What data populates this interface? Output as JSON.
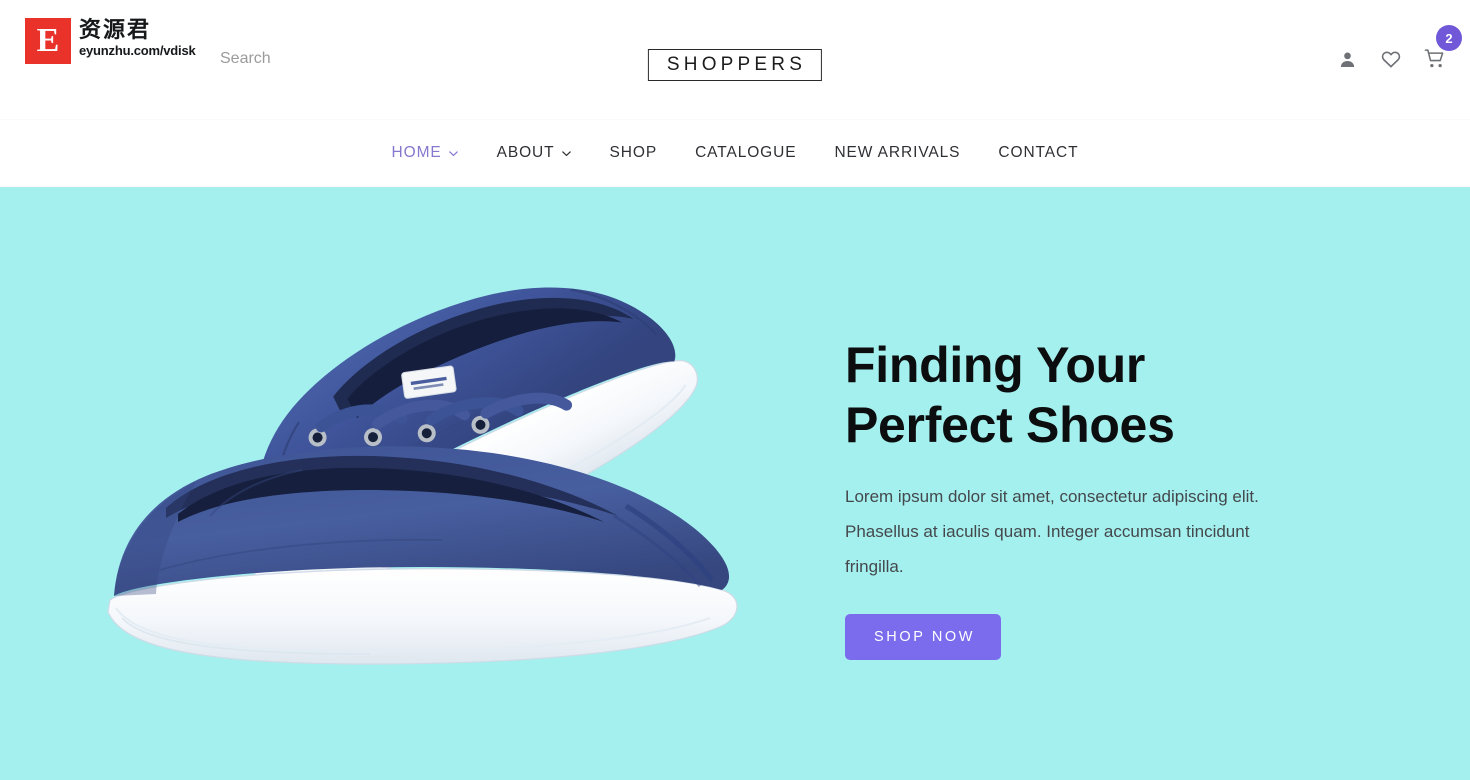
{
  "header": {
    "brand": {
      "mark_letter": "E",
      "mark_color": "#e8322a",
      "chinese_name": "资源君",
      "url": "eyunzhu.com/vdisk"
    },
    "search": {
      "placeholder": "Search",
      "value": ""
    },
    "site_logo": "SHOPPERS",
    "actions": [
      {
        "name": "account-icon",
        "label": "Account"
      },
      {
        "name": "heart-icon",
        "label": "Wishlist"
      },
      {
        "name": "cart-icon",
        "label": "Cart"
      }
    ],
    "cart_count": "2",
    "cart_badge_color": "#7158d8"
  },
  "nav": {
    "items": [
      {
        "label": "HOME",
        "active": true,
        "has_dropdown": true
      },
      {
        "label": "ABOUT",
        "active": false,
        "has_dropdown": true
      },
      {
        "label": "SHOP",
        "active": false,
        "has_dropdown": false
      },
      {
        "label": "CATALOGUE",
        "active": false,
        "has_dropdown": false
      },
      {
        "label": "NEW ARRIVALS",
        "active": false,
        "has_dropdown": false
      },
      {
        "label": "CONTACT",
        "active": false,
        "has_dropdown": false
      }
    ],
    "active_color": "#8777cf"
  },
  "hero": {
    "background_color": "#a4f0ee",
    "title_line1": "Finding Your",
    "title_line2": "Perfect Shoes",
    "paragraph": "Lorem ipsum dolor sit amet, consectetur adipiscing elit. Phasellus at iaculis quam. Integer accumsan tincidunt fringilla.",
    "cta_label": "SHOP NOW",
    "cta_color": "#7b6ced",
    "image": {
      "name": "navy-canvas-sneakers",
      "shoe_color": "#41589c",
      "shoe_color_dark": "#2e3f74",
      "sole_color": "#fdfdfd"
    }
  }
}
